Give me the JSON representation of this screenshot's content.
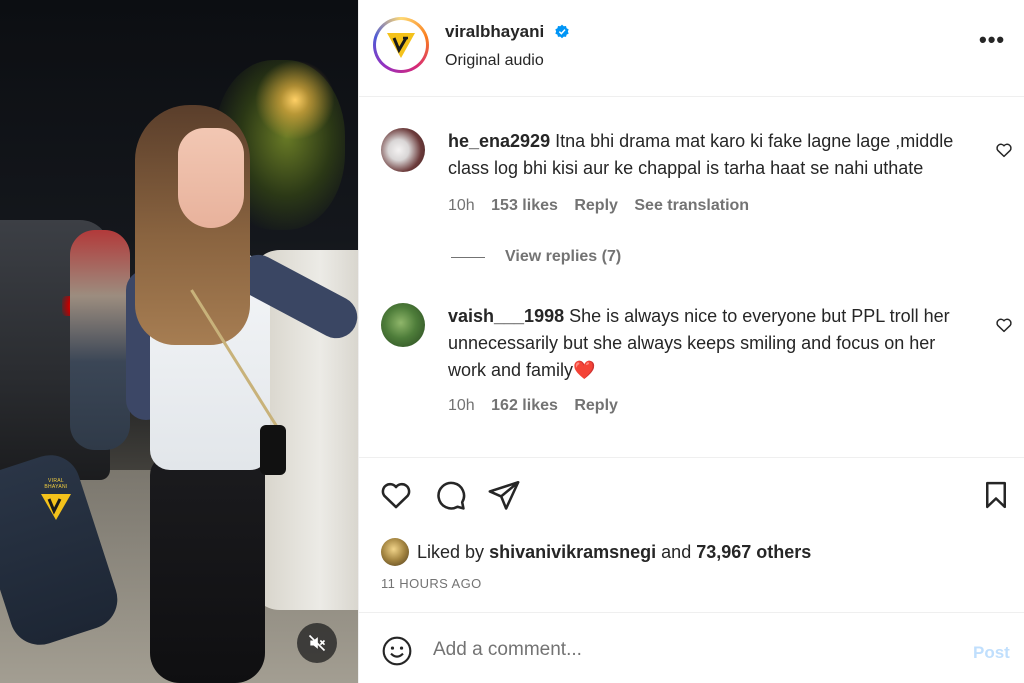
{
  "media": {
    "watermark_text": "VIRAL BHAYANI",
    "mute_icon": "speaker-muted-icon"
  },
  "header": {
    "username": "viralbhayani",
    "verified_icon": "verified-badge-icon",
    "subtitle": "Original audio",
    "more_label": "•••"
  },
  "comments": [
    {
      "handle": "he_ena2929",
      "text": "Itna bhi drama mat karo ki fake lagne lage ,middle class log bhi kisi aur ke chappal is tarha haat se nahi uthate",
      "time": "10h",
      "likes": "153 likes",
      "reply": "Reply",
      "translation": "See translation",
      "view_replies": "View replies (7)"
    },
    {
      "handle": "vaish___1998",
      "text": "She is always nice to everyone but PPL troll her unnecessarily but she always keeps smiling and focus on her work and family",
      "emoji": "❤️",
      "time": "10h",
      "likes": "162 likes",
      "reply": "Reply"
    }
  ],
  "liked_by": {
    "prefix": "Liked by",
    "user": "shivanivikramsnegi",
    "middle": "and",
    "others": "73,967 others"
  },
  "timestamp": "11 HOURS AGO",
  "composer": {
    "placeholder": "Add a comment...",
    "post_label": "Post"
  },
  "colors": {
    "verified": "#0095f6",
    "post_disabled": "#c0dffd",
    "muted_text": "#737373"
  }
}
